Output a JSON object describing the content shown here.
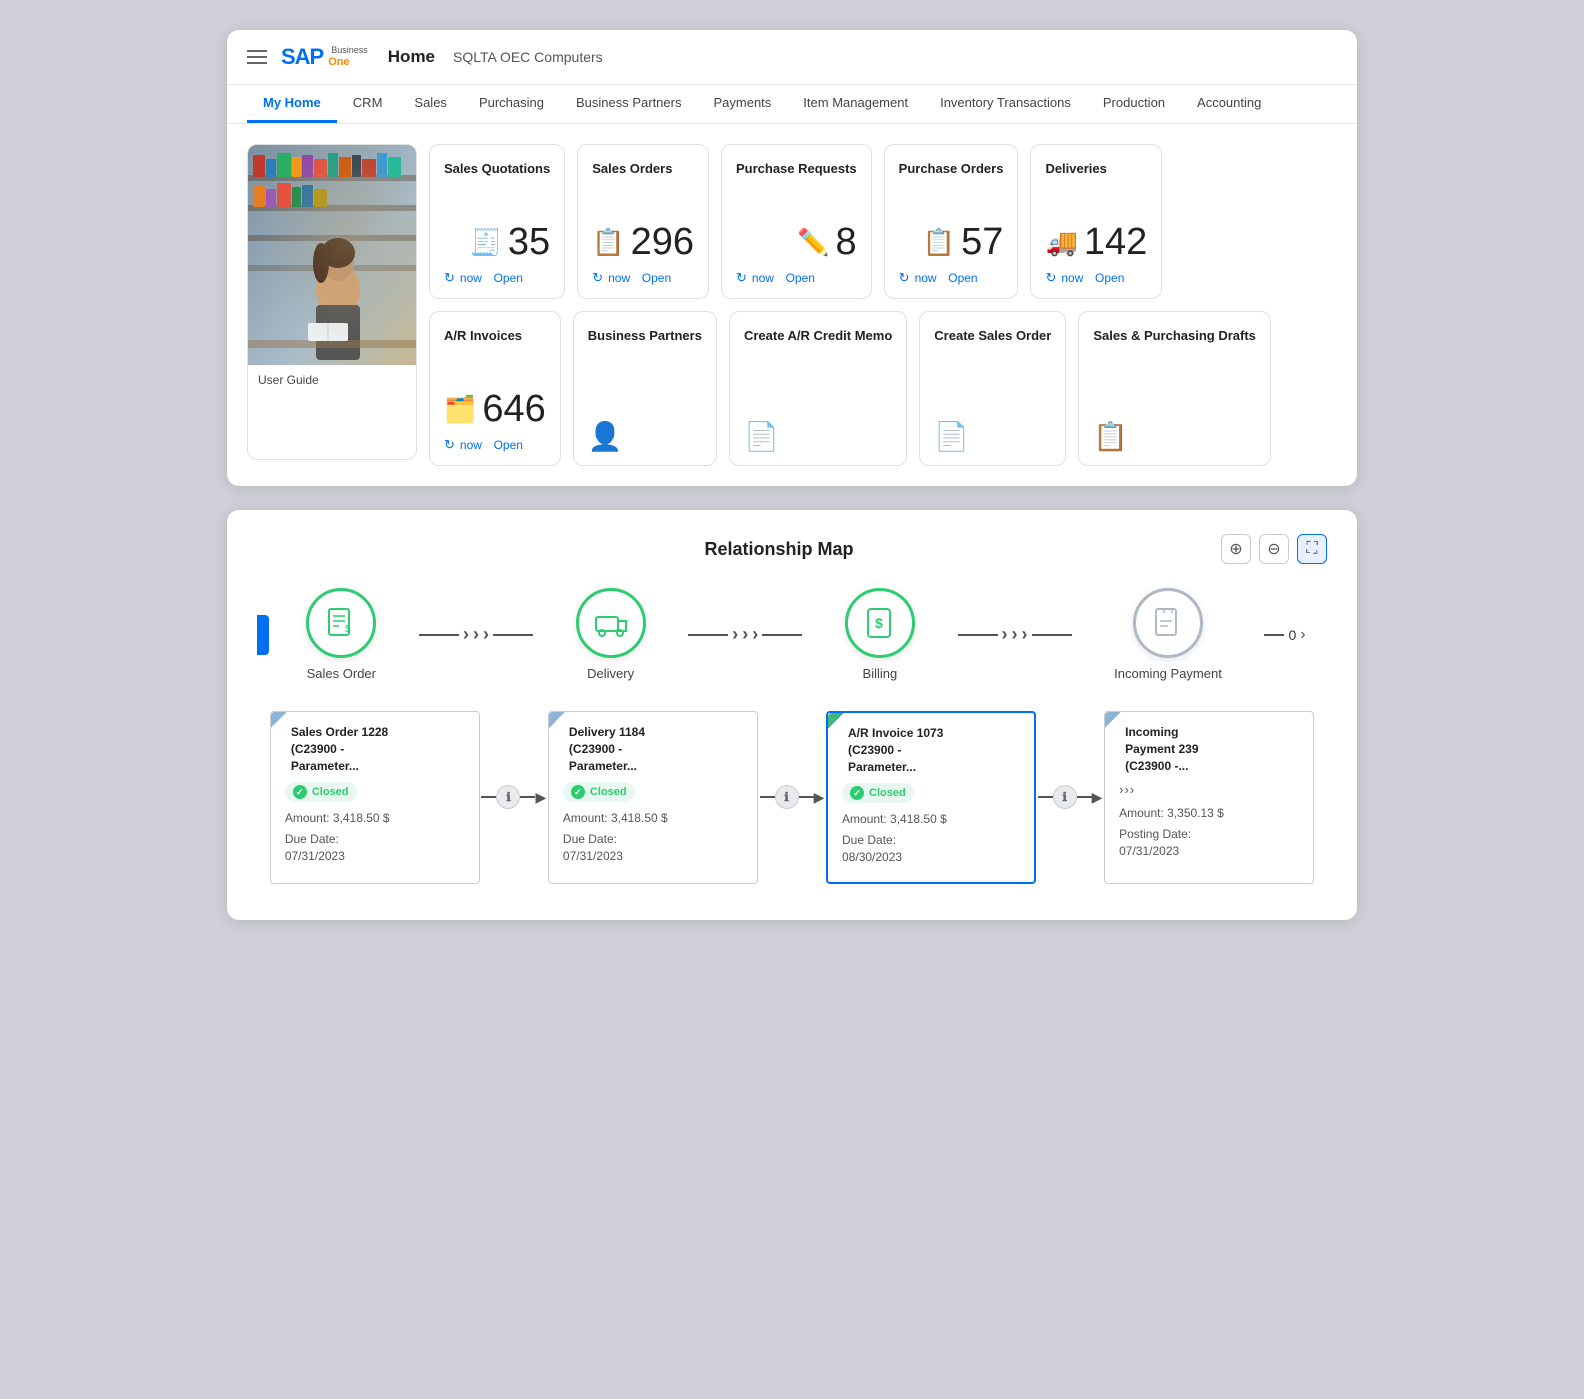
{
  "header": {
    "title": "Home",
    "subtitle": "SQLTA OEC Computers",
    "logo_sap": "SAP",
    "logo_business": "Business\nOne"
  },
  "nav": {
    "tabs": [
      {
        "label": "My Home",
        "active": true
      },
      {
        "label": "CRM",
        "active": false
      },
      {
        "label": "Sales",
        "active": false
      },
      {
        "label": "Purchasing",
        "active": false
      },
      {
        "label": "Business Partners",
        "active": false
      },
      {
        "label": "Payments",
        "active": false
      },
      {
        "label": "Item Management",
        "active": false
      },
      {
        "label": "Inventory Transactions",
        "active": false
      },
      {
        "label": "Production",
        "active": false
      },
      {
        "label": "Accounting",
        "active": false
      }
    ]
  },
  "stat_cards": [
    {
      "title": "Sales Quotations",
      "icon": "🧾",
      "number": "35",
      "footer_refresh": "now",
      "footer_text": "Open"
    },
    {
      "title": "Sales Orders",
      "icon": "📋",
      "number": "296",
      "footer_refresh": "now",
      "footer_text": "Open"
    },
    {
      "title": "Purchase Requests",
      "icon": "✏️",
      "number": "8",
      "footer_refresh": "now",
      "footer_text": "Open"
    },
    {
      "title": "Purchase Orders",
      "icon": "📋",
      "number": "57",
      "footer_refresh": "now",
      "footer_text": "Open"
    },
    {
      "title": "Deliveries",
      "icon": "🚚",
      "number": "142",
      "footer_refresh": "now",
      "footer_text": "Open"
    },
    {
      "title": "A/R Invoices",
      "icon": "🗂️",
      "number": "646",
      "footer_refresh": "now",
      "footer_text": "Open"
    }
  ],
  "action_cards": [
    {
      "title": "Business Partners",
      "icon": "👤"
    },
    {
      "title": "Create A/R Credit Memo",
      "icon": "📄"
    },
    {
      "title": "Create Sales Order",
      "icon": "📄"
    },
    {
      "title": "Sales & Purchasing Drafts",
      "icon": "📋"
    }
  ],
  "user_guide_label": "User Guide",
  "relationship_map": {
    "title": "Relationship Map",
    "nodes": [
      {
        "label": "Sales Order",
        "icon": "📋",
        "faded": false
      },
      {
        "label": "Delivery",
        "icon": "🚚",
        "faded": false
      },
      {
        "label": "Billing",
        "icon": "💲",
        "faded": false
      },
      {
        "label": "Incoming Payment",
        "icon": "📄",
        "faded": true
      }
    ],
    "end_number": "0",
    "doc_cards": [
      {
        "title": "Sales Order 1228\n(C23900 -\nParameter...",
        "status": "Closed",
        "amount_label": "Amount:",
        "amount_value": "3,418.50 $",
        "date_label": "Due Date:",
        "date_value": "07/31/2023",
        "corner": "blue",
        "highlighted": false
      },
      {
        "title": "Delivery 1184\n(C23900 -\nParameter...",
        "status": "Closed",
        "amount_label": "Amount:",
        "amount_value": "3,418.50 $",
        "date_label": "Due Date:",
        "date_value": "07/31/2023",
        "corner": "blue",
        "highlighted": false
      },
      {
        "title": "A/R Invoice 1073\n(C23900 -\nParameter...",
        "status": "Closed",
        "amount_label": "Amount:",
        "amount_value": "3,418.50 $",
        "date_label": "Due Date:",
        "date_value": "08/30/2023",
        "corner": "green",
        "highlighted": true
      },
      {
        "title": "Incoming\nPayment 239\n(C23900 -...",
        "status": null,
        "amount_label": "Amount:",
        "amount_value": "3,350.13 $",
        "date_label": "Posting Date:",
        "date_value": "07/31/2023",
        "corner": "blue",
        "highlighted": false
      }
    ]
  }
}
